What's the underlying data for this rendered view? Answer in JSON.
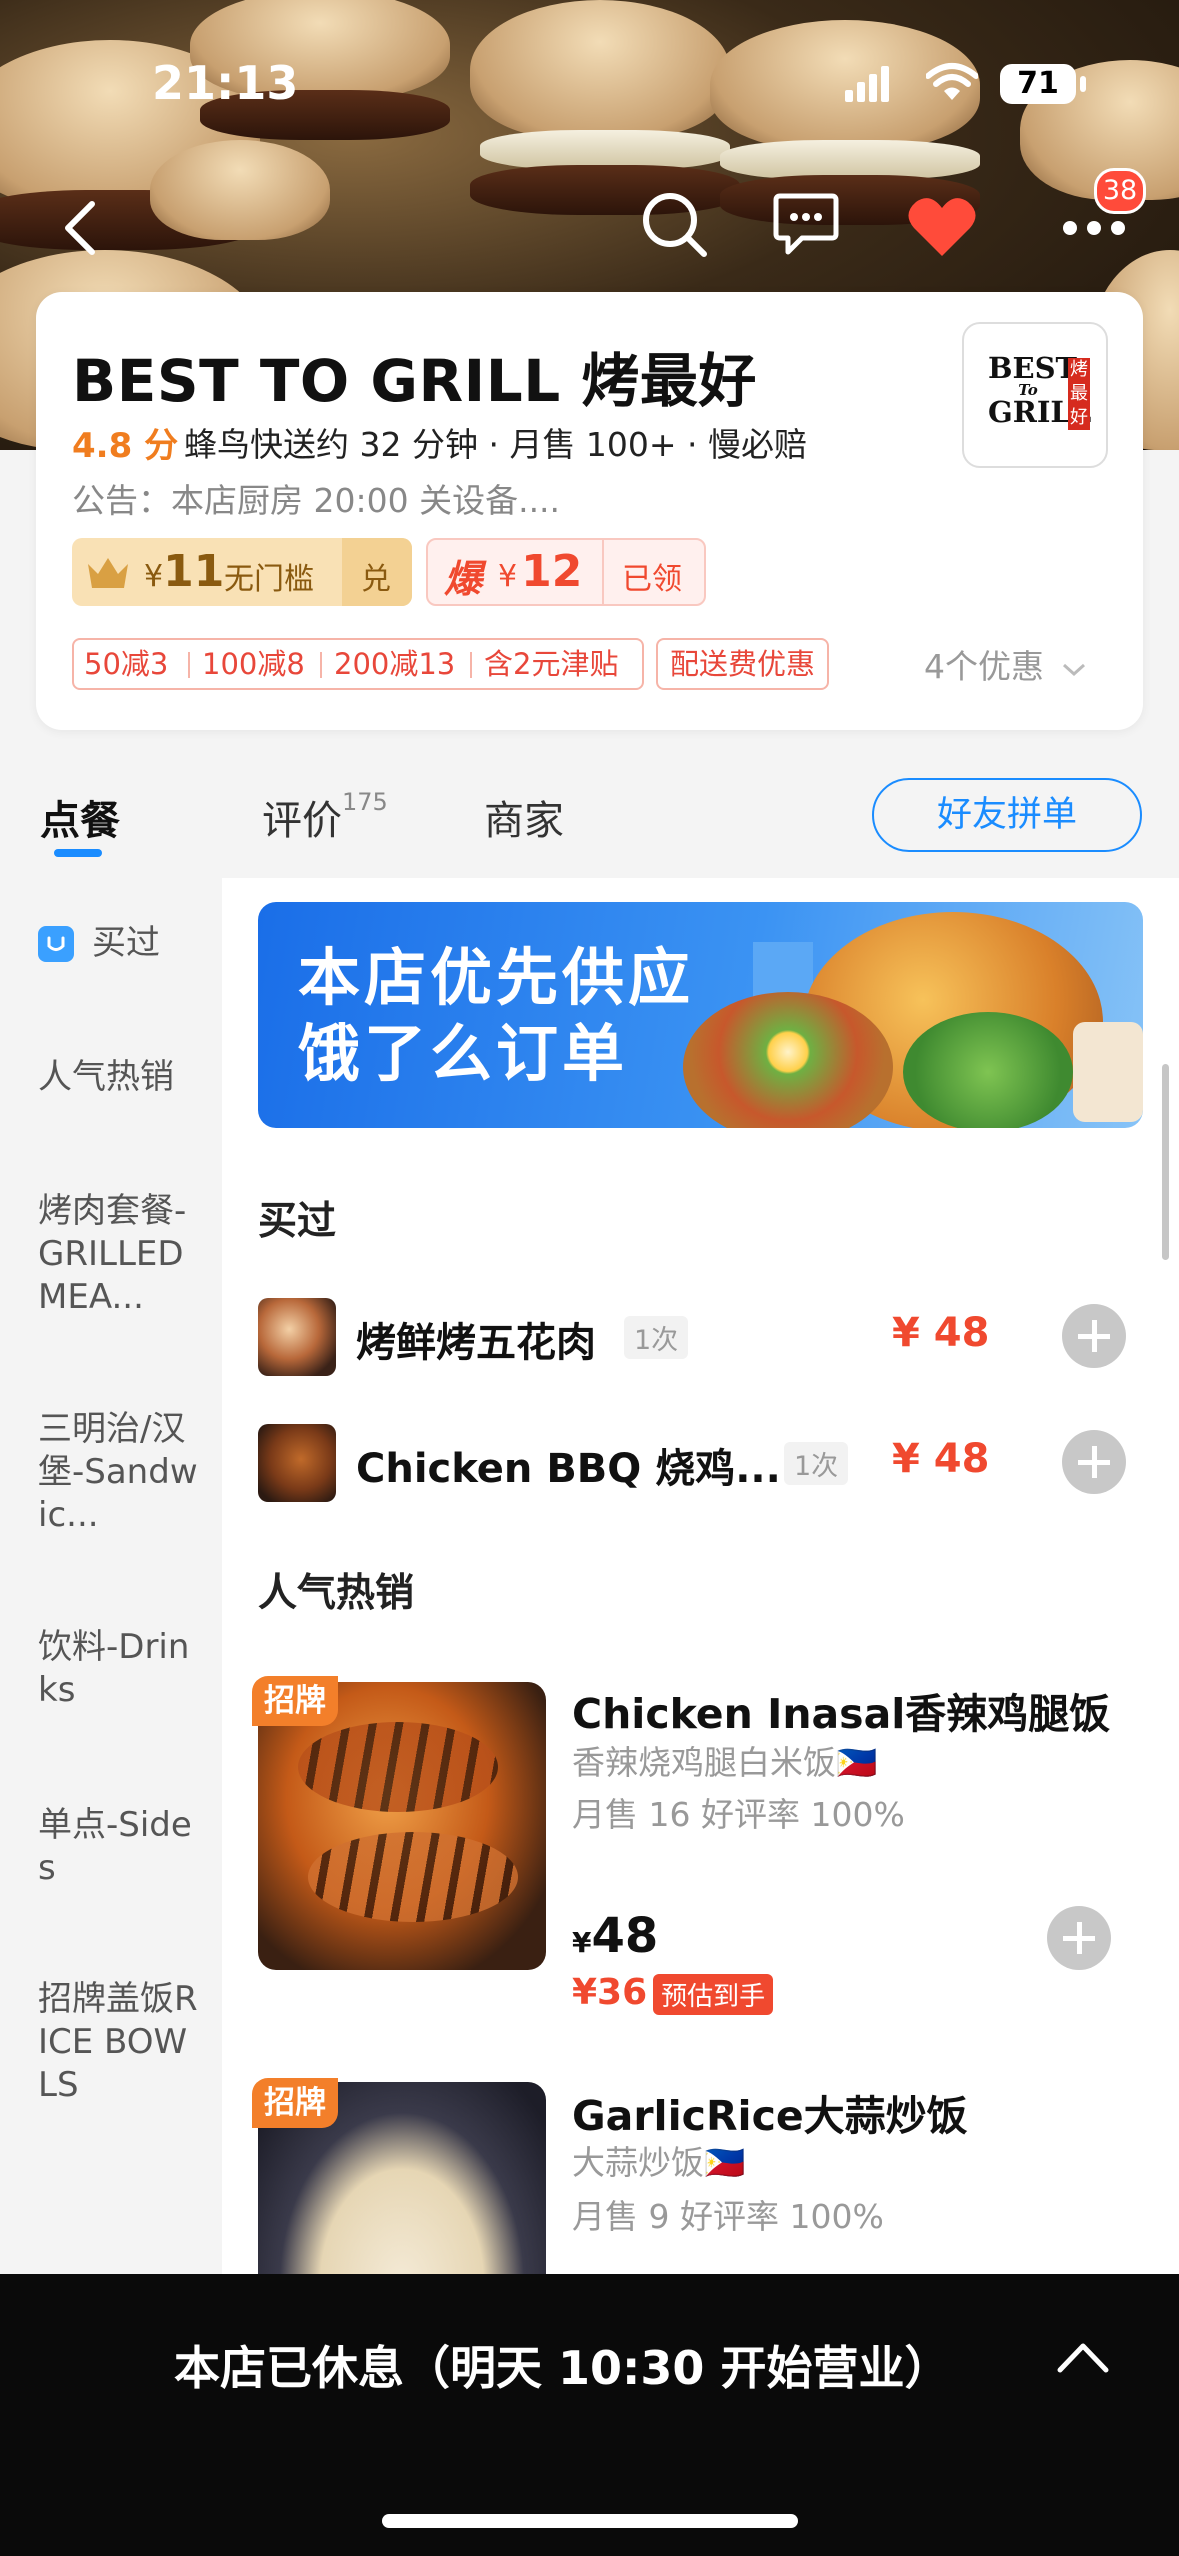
{
  "status": {
    "time": "21:13",
    "battery": "71"
  },
  "header": {
    "notification_count": "38"
  },
  "shop": {
    "name": "BEST TO GRILL 烤最好",
    "rating": "4.8 分",
    "metrics": "蜂鸟快送约 32 分钟 · 月售 100+ · 慢必赔",
    "notice": "公告：本店厨房 20:00 关设备....",
    "logo_lines": [
      "BEST",
      "To",
      "GRILL"
    ],
    "logo_side": "烤最好"
  },
  "coupons": {
    "c1_symbol": "¥",
    "c1_amount": "11",
    "c1_label": "无门槛",
    "c1_action": "兑",
    "c2_prefix": "爆",
    "c2_symbol": "¥",
    "c2_amount": "12",
    "c2_status": "已领"
  },
  "promo_tags": [
    "50减3",
    "100减8",
    "200减13",
    "含2元津贴"
  ],
  "delivery_tag": "配送费优惠",
  "more_offers": "4个优惠",
  "tabs": {
    "order": "点餐",
    "reviews": "评价",
    "reviews_count": "175",
    "merchant": "商家",
    "friends": "好友拼单"
  },
  "sidebar": {
    "items": [
      "买过",
      "人气热销",
      "烤肉套餐-GRILLED MEA...",
      "三明治/汉堡-Sandwic...",
      "饮料-Drinks",
      "单点-Sides",
      "招牌盖饭RICE BOWLS"
    ]
  },
  "banner": {
    "line1": "本店优先供应",
    "line2": "饿了么订单"
  },
  "bought": {
    "title": "买过",
    "items": [
      {
        "name": "烤鲜烤五花肉",
        "count": "1次",
        "price": "¥ 48"
      },
      {
        "name": "Chicken BBQ 烧鸡...",
        "count": "1次",
        "price": "¥ 48"
      }
    ]
  },
  "hot": {
    "title": "人气热销",
    "items": [
      {
        "badge": "招牌",
        "name": "Chicken Inasal香辣鸡腿饭",
        "desc": "香辣烧鸡腿白米饭🇵🇭",
        "stats": "月售 16  好评率 100%",
        "price_symbol": "¥",
        "price": "48",
        "deal": "¥36",
        "deal_label": "预估到手"
      },
      {
        "badge": "招牌",
        "name": "GarlicRice大蒜炒饭",
        "desc": "大蒜炒饭🇵🇭",
        "stats": "月售 9  好评率 100%"
      }
    ]
  },
  "footer": {
    "closed": "本店已休息（明天 10:30 开始营业）"
  }
}
